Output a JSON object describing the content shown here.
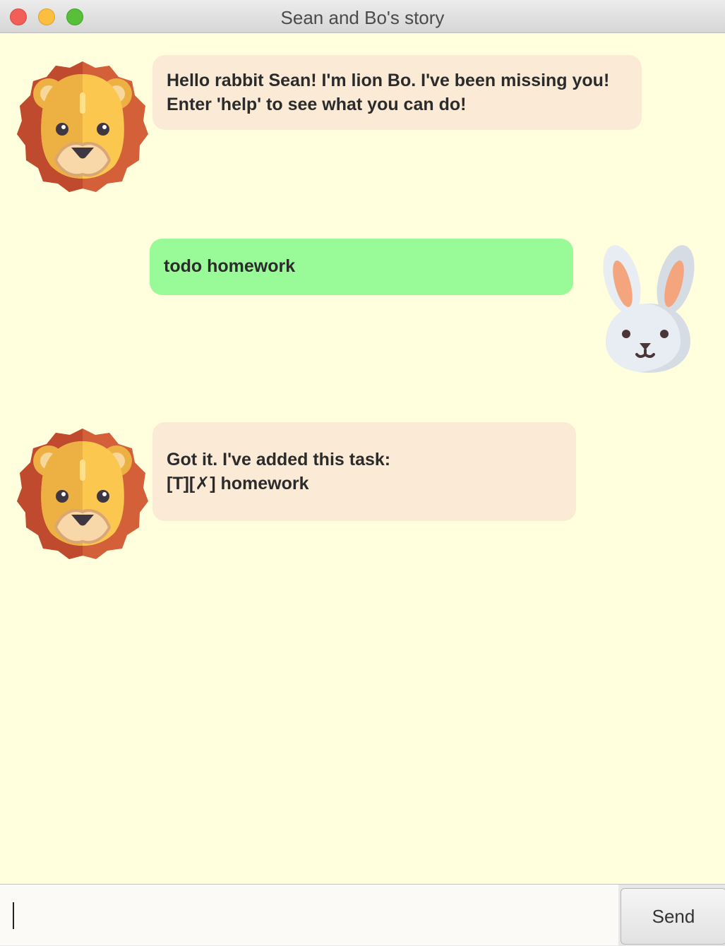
{
  "window": {
    "title": "Sean and Bo's story"
  },
  "messages": [
    {
      "sender": "bot",
      "avatar_icon": "lion-icon",
      "text": "Hello rabbit Sean! I'm lion Bo. I've been missing you!\nEnter 'help' to see what you can do!"
    },
    {
      "sender": "user",
      "avatar_icon": "rabbit-icon",
      "text": "todo homework"
    },
    {
      "sender": "bot",
      "avatar_icon": "lion-icon",
      "text": "Got it. I've added this task:\n[T][✗] homework"
    }
  ],
  "input": {
    "value": "",
    "send_label": "Send"
  },
  "colors": {
    "background": "#FFFEDD",
    "bot_bubble": "#FAEAD6",
    "user_bubble": "#98FB98"
  }
}
